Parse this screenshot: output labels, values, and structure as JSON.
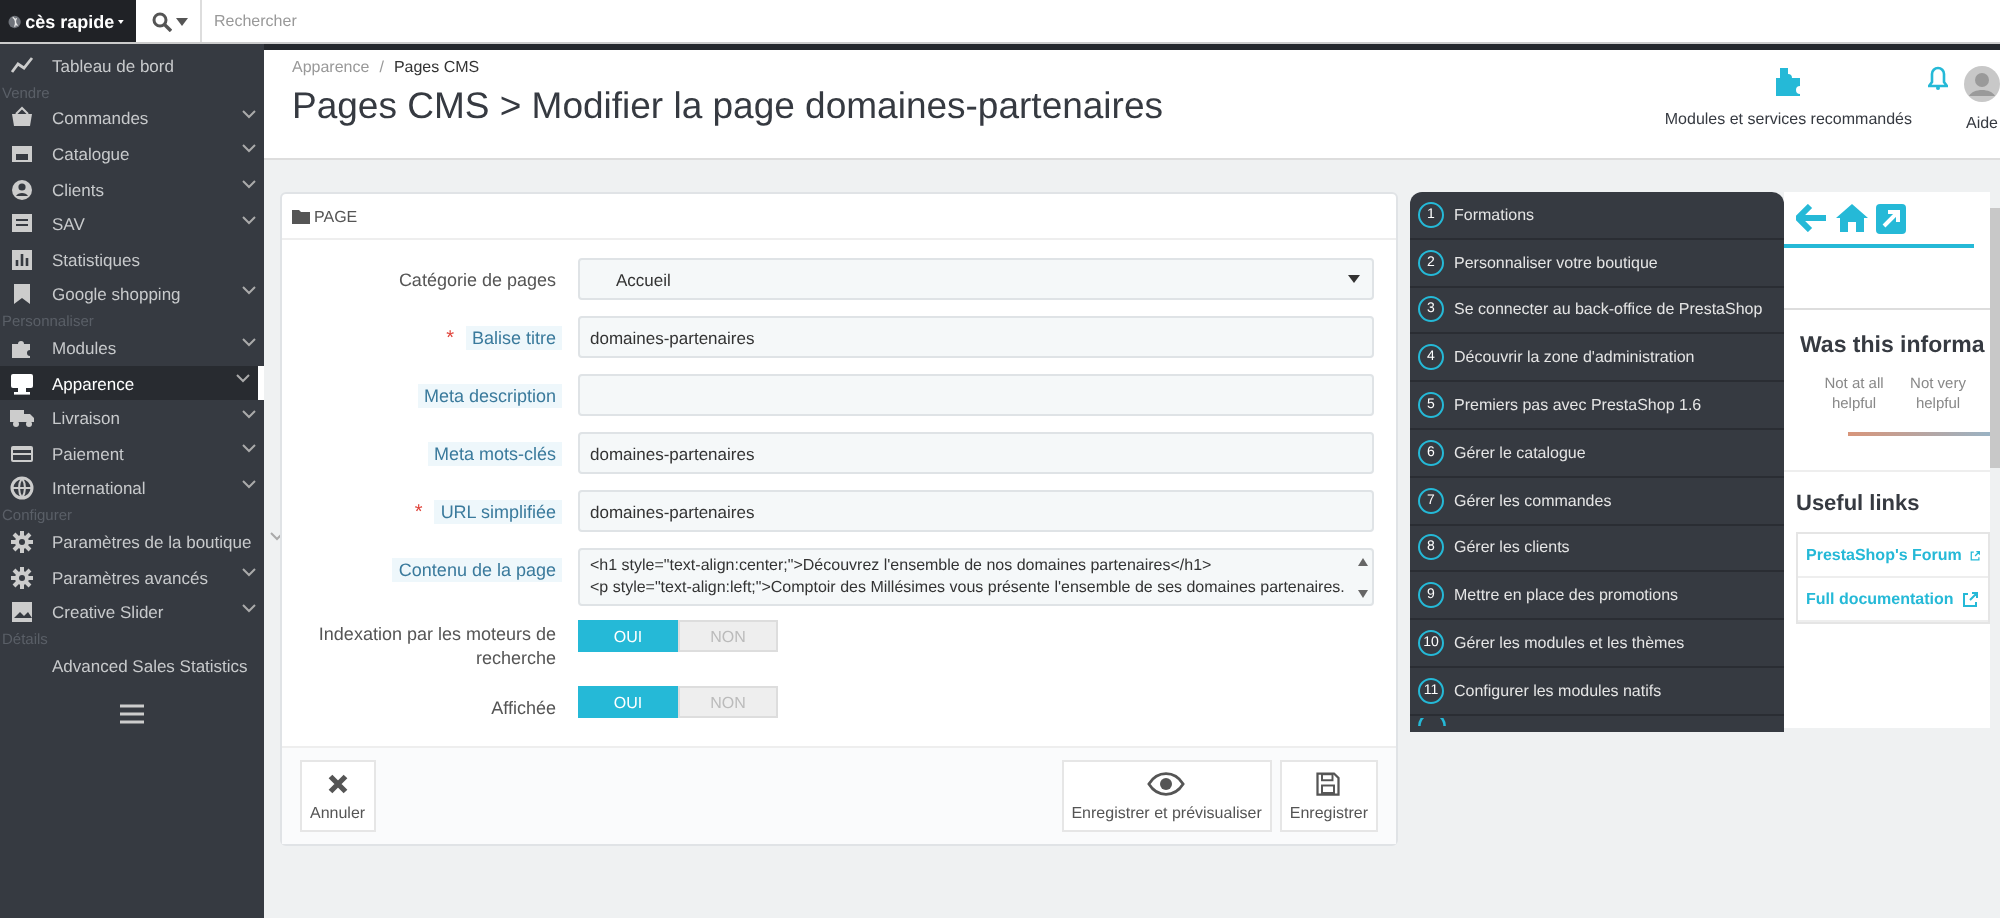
{
  "topbar": {
    "quick_access": "cès rapide",
    "search_placeholder": "Rechercher"
  },
  "sidebar": {
    "sections": [
      {
        "items": [
          {
            "label": "Tableau de bord",
            "submenu": false,
            "selected": false
          }
        ]
      },
      {
        "title": "Vendre",
        "items": [
          {
            "label": "Commandes",
            "submenu": true,
            "selected": false
          },
          {
            "label": "Catalogue",
            "submenu": true,
            "selected": false
          },
          {
            "label": "Clients",
            "submenu": true,
            "selected": false
          },
          {
            "label": "SAV",
            "submenu": true,
            "selected": false
          },
          {
            "label": "Statistiques",
            "submenu": false,
            "selected": false
          },
          {
            "label": "Google shopping",
            "submenu": true,
            "selected": false
          }
        ]
      },
      {
        "title": "Personnaliser",
        "items": [
          {
            "label": "Modules",
            "submenu": true,
            "selected": false
          },
          {
            "label": "Apparence",
            "submenu": true,
            "selected": true
          },
          {
            "label": "Livraison",
            "submenu": true,
            "selected": false
          },
          {
            "label": "Paiement",
            "submenu": true,
            "selected": false
          },
          {
            "label": "International",
            "submenu": true,
            "selected": false
          }
        ]
      },
      {
        "title": "Configurer",
        "items": [
          {
            "label": "Paramètres de la boutique",
            "submenu": true,
            "selected": false
          },
          {
            "label": "Paramètres avancés",
            "submenu": true,
            "selected": false
          },
          {
            "label": "Creative Slider",
            "submenu": true,
            "selected": false
          }
        ]
      },
      {
        "title": "Détails",
        "items": [
          {
            "label": "Advanced Sales Statistics",
            "submenu": false,
            "selected": false
          }
        ]
      }
    ]
  },
  "header": {
    "breadcrumb": {
      "items": [
        "Apparence",
        "Pages CMS"
      ],
      "separator": "/"
    },
    "title": "Pages CMS > Modifier la page domaines-partenaires",
    "actions": [
      "Modules et services recommandés",
      "Aide"
    ]
  },
  "form": {
    "title": "PAGE",
    "required_mark": "*",
    "fields": [
      {
        "kind": "select",
        "label": "Catégorie de pages",
        "required": false,
        "tooltip": false,
        "value": "Accueil"
      },
      {
        "kind": "input",
        "label": "Balise titre",
        "required": true,
        "tooltip": true,
        "value": "domaines-partenaires"
      },
      {
        "kind": "input",
        "label": "Meta description",
        "required": false,
        "tooltip": true
      },
      {
        "kind": "input",
        "label": "Meta mots-clés",
        "required": false,
        "tooltip": true,
        "value": "domaines-partenaires"
      },
      {
        "kind": "input",
        "label": "URL simplifiée",
        "required": true,
        "tooltip": true,
        "value": "domaines-partenaires"
      },
      {
        "kind": "textarea",
        "label": "Contenu de la page",
        "required": false,
        "tooltip": true,
        "lines": [
          "<h1 style=\"text-align:center;\">Découvrez l'ensemble de nos domaines partenaires</h1>",
          "<p style=\"text-align:left;\">Comptoir des Millésimes vous présente l'ensemble de ses domaines partenaires."
        ]
      },
      {
        "kind": "switch",
        "label": "Indexation par les moteurs de recherche",
        "required": false,
        "tooltip": false,
        "options": [
          {
            "label": "OUI",
            "selected": true
          },
          {
            "label": "NON",
            "selected": false
          }
        ]
      },
      {
        "kind": "switch",
        "label": "Affichée",
        "required": false,
        "tooltip": false,
        "options": [
          {
            "label": "OUI",
            "selected": true
          },
          {
            "label": "NON",
            "selected": false
          }
        ]
      }
    ],
    "left_buttons": [
      "Annuler"
    ],
    "right_buttons": [
      "Enregistrer et prévisualiser",
      "Enregistrer"
    ]
  },
  "help": {
    "steps": [
      {
        "number": "1",
        "label": "Formations"
      },
      {
        "number": "2",
        "label": "Personnaliser votre boutique"
      },
      {
        "number": "3",
        "label": "Se connecter au back-office de PrestaShop"
      },
      {
        "number": "4",
        "label": "Découvrir la zone d'administration"
      },
      {
        "number": "5",
        "label": "Premiers pas avec PrestaShop 1.6"
      },
      {
        "number": "6",
        "label": "Gérer le catalogue"
      },
      {
        "number": "7",
        "label": "Gérer les commandes"
      },
      {
        "number": "8",
        "label": "Gérer les clients"
      },
      {
        "number": "9",
        "label": "Mettre en place des promotions"
      },
      {
        "number": "10",
        "label": "Gérer les modules et les thèmes"
      },
      {
        "number": "11",
        "label": "Configurer les modules natifs"
      }
    ],
    "feedback": {
      "question": "Was this informa",
      "options": [
        "Not at all helpful",
        "Not very helpful"
      ]
    },
    "useful_links": {
      "title": "Useful links",
      "links": [
        "PrestaShop's Forum",
        "Full documentation"
      ]
    }
  }
}
